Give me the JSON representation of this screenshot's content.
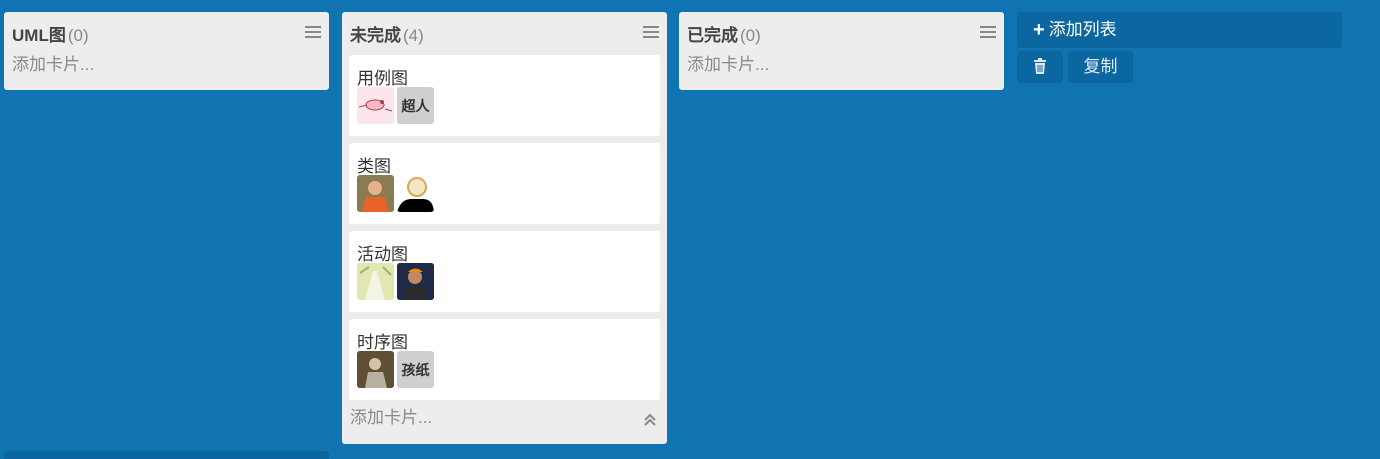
{
  "lists": [
    {
      "title": "UML图",
      "count": "(0)",
      "add_card": "添加卡片..."
    },
    {
      "title": "未完成",
      "count": "(4)",
      "add_card": "添加卡片...",
      "cards": [
        {
          "title": "用例图",
          "members": [
            {
              "type": "pink-photo"
            },
            {
              "type": "text",
              "label": "超人"
            }
          ]
        },
        {
          "title": "类图",
          "members": [
            {
              "type": "orange-photo"
            },
            {
              "type": "sketch-photo"
            }
          ]
        },
        {
          "title": "活动图",
          "members": [
            {
              "type": "green-photo"
            },
            {
              "type": "dark-photo"
            }
          ]
        },
        {
          "title": "时序图",
          "members": [
            {
              "type": "brown-photo"
            },
            {
              "type": "text",
              "label": "孩纸"
            }
          ]
        }
      ]
    },
    {
      "title": "已完成",
      "count": "(0)",
      "add_card": "添加卡片..."
    }
  ],
  "add_list": {
    "label": "添加列表",
    "icon": "plus-icon"
  },
  "actions": {
    "delete_icon": "trash-icon",
    "copy_label": "复制"
  },
  "colors": {
    "board_bg": "#0f74b1",
    "list_bg": "#ededed",
    "button_bg": "#0c67a0"
  }
}
